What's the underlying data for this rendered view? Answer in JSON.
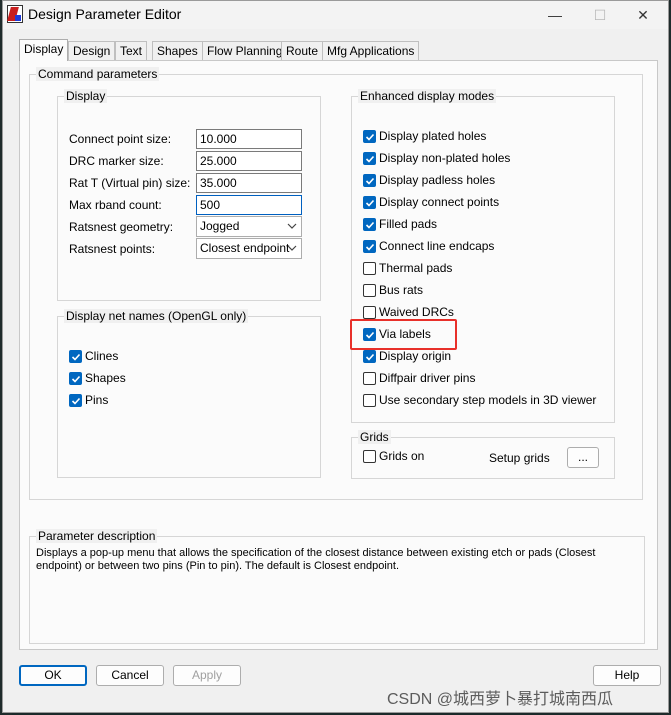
{
  "window": {
    "title": "Design Parameter Editor",
    "controls": {
      "minimize": "—",
      "maximize": "☐",
      "close": "✕"
    }
  },
  "tabs": [
    "Display",
    "Design",
    "Text",
    "Shapes",
    "Flow Planning",
    "Route",
    "Mfg Applications"
  ],
  "active_tab": "Display",
  "command_parameters": {
    "title": "Command parameters",
    "display": {
      "title": "Display",
      "connect_point_size": {
        "label": "Connect point size:",
        "value": "10.000"
      },
      "drc_marker_size": {
        "label": "DRC marker size:",
        "value": "25.000"
      },
      "rat_t_size": {
        "label": "Rat T (Virtual pin) size:",
        "value": "35.000"
      },
      "max_rband_count": {
        "label": "Max rband count:",
        "value": "500"
      },
      "ratsnest_geometry": {
        "label": "Ratsnest geometry:",
        "value": "Jogged"
      },
      "ratsnest_points": {
        "label": "Ratsnest points:",
        "value": "Closest endpoint"
      }
    },
    "net_names": {
      "title": "Display net names (OpenGL only)",
      "items": [
        {
          "label": "Clines",
          "checked": true
        },
        {
          "label": "Shapes",
          "checked": true
        },
        {
          "label": "Pins",
          "checked": true
        }
      ]
    },
    "enhanced": {
      "title": "Enhanced display modes",
      "items": [
        {
          "label": "Display plated holes",
          "checked": true
        },
        {
          "label": "Display non-plated holes",
          "checked": true
        },
        {
          "label": "Display padless holes",
          "checked": true
        },
        {
          "label": "Display connect points",
          "checked": true
        },
        {
          "label": "Filled pads",
          "checked": true
        },
        {
          "label": "Connect line endcaps",
          "checked": true
        },
        {
          "label": "Thermal pads",
          "checked": false
        },
        {
          "label": "Bus rats",
          "checked": false
        },
        {
          "label": "Waived DRCs",
          "checked": false
        },
        {
          "label": "Via labels",
          "checked": true
        },
        {
          "label": "Display origin",
          "checked": true
        },
        {
          "label": "Diffpair driver pins",
          "checked": false
        },
        {
          "label": "Use secondary step models in 3D viewer",
          "checked": false
        }
      ]
    },
    "grids": {
      "title": "Grids",
      "grids_on": {
        "label": "Grids on",
        "checked": false
      },
      "setup_label": "Setup grids",
      "setup_button": "..."
    }
  },
  "parameter_description": {
    "title": "Parameter description",
    "text": "Displays a pop-up menu that allows the specification of the closest distance between existing etch or pads (Closest endpoint) or between two pins (Pin to pin). The default is Closest endpoint."
  },
  "buttons": {
    "ok": "OK",
    "cancel": "Cancel",
    "apply": "Apply",
    "help": "Help"
  },
  "watermark": "CSDN @城西萝卜暴打城南西瓜",
  "colors": {
    "accent": "#0067c0",
    "highlight": "#e8302a"
  }
}
